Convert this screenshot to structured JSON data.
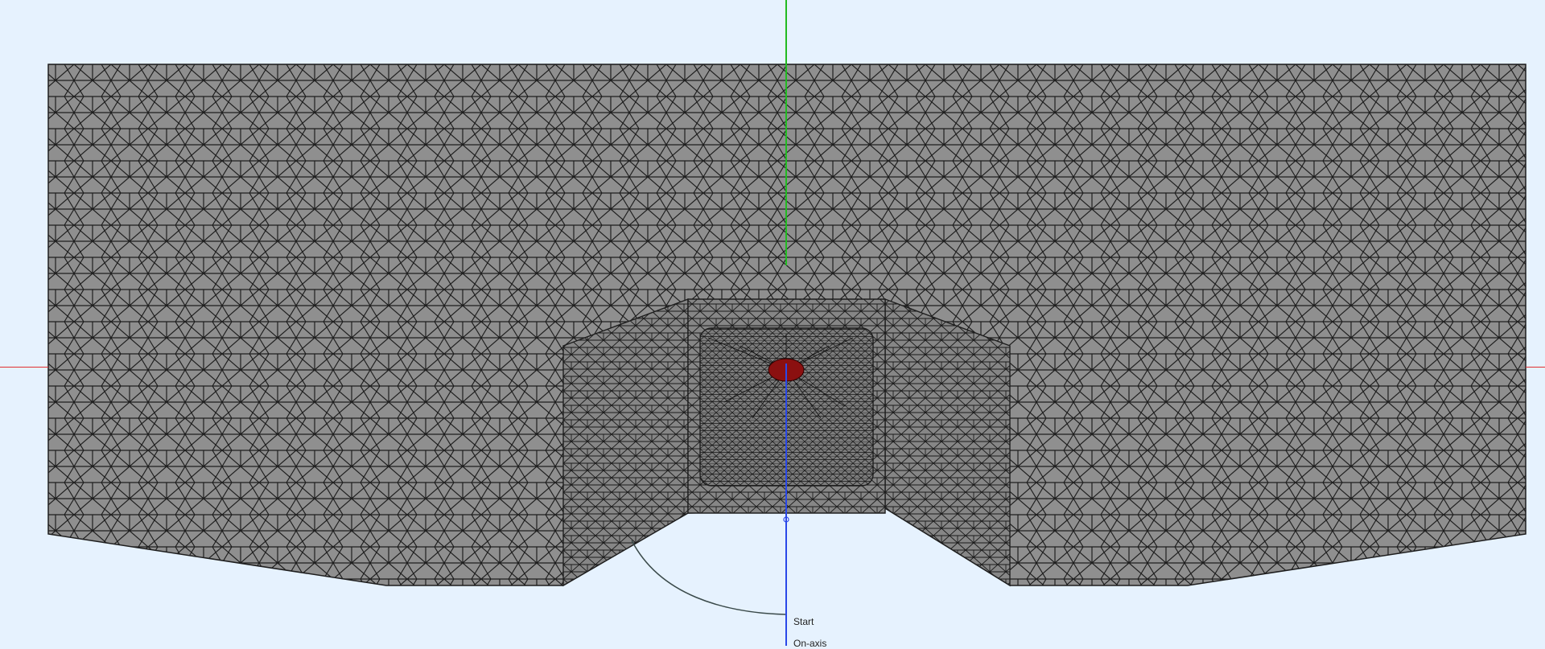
{
  "colors": {
    "background": "#e6f2fe",
    "mesh_fill": "#8f8f8f",
    "mesh_fill_inner": "#868686",
    "mesh_line": "#1e1e1e",
    "red_axis": "#e03030",
    "green_axis": "#22bb22",
    "blue_axis": "#2a48e8",
    "highlight": "#8b1010"
  },
  "icons": {
    "inference_point": "endpoint-dot-icon",
    "hotspot": "mesh-hotspot-icon"
  },
  "inference": {
    "start_label": "Start",
    "on_axis_label": "On-axis"
  }
}
